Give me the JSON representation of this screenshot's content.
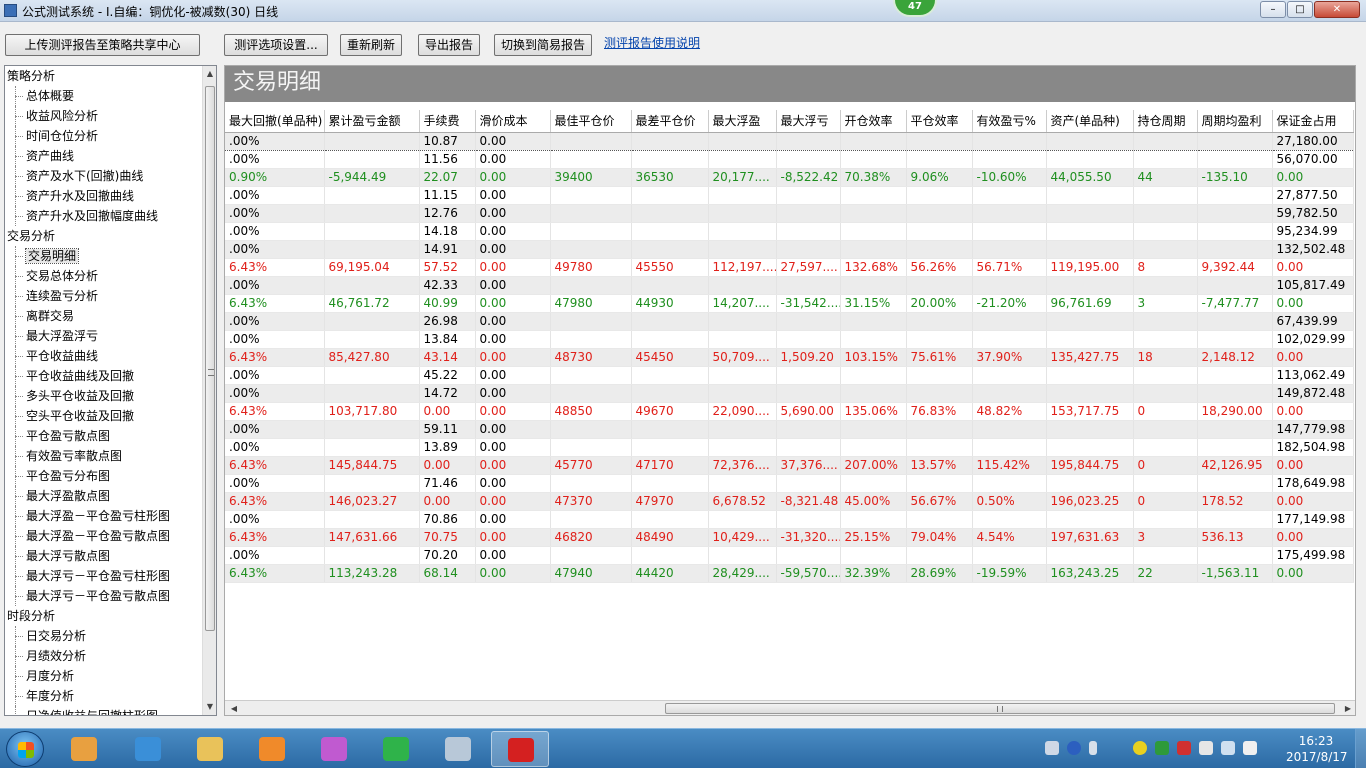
{
  "window": {
    "title": "公式测试系统 - I.自编：铜优化-被减数(30) 日线",
    "badge": "47",
    "min": "–",
    "max": "□",
    "close": "✕"
  },
  "toolbar": {
    "upload": "上传测评报告至策略共享中心",
    "options": "测评选项设置...",
    "refresh": "重新刷新",
    "export": "导出报告",
    "switch": "切换到简易报告",
    "help": "测评报告使用说明"
  },
  "tree": [
    {
      "label": "策略分析",
      "level": 0
    },
    {
      "label": "总体概要",
      "level": 1
    },
    {
      "label": "收益风险分析",
      "level": 1
    },
    {
      "label": "时间仓位分析",
      "level": 1
    },
    {
      "label": "资产曲线",
      "level": 1
    },
    {
      "label": "资产及水下(回撤)曲线",
      "level": 1
    },
    {
      "label": "资产升水及回撤曲线",
      "level": 1
    },
    {
      "label": "资产升水及回撤幅度曲线",
      "level": 1
    },
    {
      "label": "交易分析",
      "level": 0
    },
    {
      "label": "交易明细",
      "level": 1,
      "selected": true
    },
    {
      "label": "交易总体分析",
      "level": 1
    },
    {
      "label": "连续盈亏分析",
      "level": 1
    },
    {
      "label": "离群交易",
      "level": 1
    },
    {
      "label": "最大浮盈浮亏",
      "level": 1
    },
    {
      "label": "平仓收益曲线",
      "level": 1
    },
    {
      "label": "平仓收益曲线及回撤",
      "level": 1
    },
    {
      "label": "多头平仓收益及回撤",
      "level": 1
    },
    {
      "label": "空头平仓收益及回撤",
      "level": 1
    },
    {
      "label": "平仓盈亏散点图",
      "level": 1
    },
    {
      "label": "有效盈亏率散点图",
      "level": 1
    },
    {
      "label": "平仓盈亏分布图",
      "level": 1
    },
    {
      "label": "最大浮盈散点图",
      "level": 1
    },
    {
      "label": "最大浮盈－平仓盈亏柱形图",
      "level": 1
    },
    {
      "label": "最大浮盈－平仓盈亏散点图",
      "level": 1
    },
    {
      "label": "最大浮亏散点图",
      "level": 1
    },
    {
      "label": "最大浮亏－平仓盈亏柱形图",
      "level": 1
    },
    {
      "label": "最大浮亏－平仓盈亏散点图",
      "level": 1
    },
    {
      "label": "时段分析",
      "level": 0
    },
    {
      "label": "日交易分析",
      "level": 1
    },
    {
      "label": "月绩效分析",
      "level": 1
    },
    {
      "label": "月度分析",
      "level": 1
    },
    {
      "label": "年度分析",
      "level": 1
    },
    {
      "label": "日净值收益与回撤柱形图",
      "level": 1
    }
  ],
  "main": {
    "title": "交易明细",
    "columns": [
      "最大回撤(单品种)",
      "累计盈亏金额",
      "手续费",
      "滑价成本",
      "最佳平仓价",
      "最差平仓价",
      "最大浮盈",
      "最大浮亏",
      "开仓效率",
      "平仓效率",
      "有效盈亏%",
      "资产(单品种)",
      "持仓周期",
      "周期均盈利",
      "保证金占用"
    ],
    "rows": [
      {
        "color": "",
        "cells": [
          ".00%",
          "",
          "10.87",
          "0.00",
          "",
          "",
          "",
          "",
          "",
          "",
          "",
          "",
          "",
          "",
          "27,180.00"
        ]
      },
      {
        "color": "",
        "cells": [
          ".00%",
          "",
          "11.56",
          "0.00",
          "",
          "",
          "",
          "",
          "",
          "",
          "",
          "",
          "",
          "",
          "56,070.00"
        ]
      },
      {
        "color": "green",
        "cells": [
          "0.90%",
          "-5,944.49",
          "22.07",
          "0.00",
          "39400",
          "36530",
          "20,177....",
          "-8,522.42",
          "70.38%",
          "9.06%",
          "-10.60%",
          "44,055.50",
          "44",
          "-135.10",
          "0.00"
        ]
      },
      {
        "color": "",
        "cells": [
          ".00%",
          "",
          "11.15",
          "0.00",
          "",
          "",
          "",
          "",
          "",
          "",
          "",
          "",
          "",
          "",
          "27,877.50"
        ]
      },
      {
        "color": "",
        "cells": [
          ".00%",
          "",
          "12.76",
          "0.00",
          "",
          "",
          "",
          "",
          "",
          "",
          "",
          "",
          "",
          "",
          "59,782.50"
        ]
      },
      {
        "color": "",
        "cells": [
          ".00%",
          "",
          "14.18",
          "0.00",
          "",
          "",
          "",
          "",
          "",
          "",
          "",
          "",
          "",
          "",
          "95,234.99"
        ]
      },
      {
        "color": "",
        "cells": [
          ".00%",
          "",
          "14.91",
          "0.00",
          "",
          "",
          "",
          "",
          "",
          "",
          "",
          "",
          "",
          "",
          "132,502.48"
        ]
      },
      {
        "color": "red",
        "cells": [
          "6.43%",
          "69,195.04",
          "57.52",
          "0.00",
          "49780",
          "45550",
          "112,197....",
          "27,597....",
          "132.68%",
          "56.26%",
          "56.71%",
          "119,195.00",
          "8",
          "9,392.44",
          "0.00"
        ]
      },
      {
        "color": "",
        "cells": [
          ".00%",
          "",
          "42.33",
          "0.00",
          "",
          "",
          "",
          "",
          "",
          "",
          "",
          "",
          "",
          "",
          "105,817.49"
        ]
      },
      {
        "color": "green",
        "cells": [
          "6.43%",
          "46,761.72",
          "40.99",
          "0.00",
          "47980",
          "44930",
          "14,207....",
          "-31,542....",
          "31.15%",
          "20.00%",
          "-21.20%",
          "96,761.69",
          "3",
          "-7,477.77",
          "0.00"
        ]
      },
      {
        "color": "",
        "cells": [
          ".00%",
          "",
          "26.98",
          "0.00",
          "",
          "",
          "",
          "",
          "",
          "",
          "",
          "",
          "",
          "",
          "67,439.99"
        ]
      },
      {
        "color": "",
        "cells": [
          ".00%",
          "",
          "13.84",
          "0.00",
          "",
          "",
          "",
          "",
          "",
          "",
          "",
          "",
          "",
          "",
          "102,029.99"
        ]
      },
      {
        "color": "red",
        "cells": [
          "6.43%",
          "85,427.80",
          "43.14",
          "0.00",
          "48730",
          "45450",
          "50,709....",
          "1,509.20",
          "103.15%",
          "75.61%",
          "37.90%",
          "135,427.75",
          "18",
          "2,148.12",
          "0.00"
        ]
      },
      {
        "color": "",
        "cells": [
          ".00%",
          "",
          "45.22",
          "0.00",
          "",
          "",
          "",
          "",
          "",
          "",
          "",
          "",
          "",
          "",
          "113,062.49"
        ]
      },
      {
        "color": "",
        "cells": [
          ".00%",
          "",
          "14.72",
          "0.00",
          "",
          "",
          "",
          "",
          "",
          "",
          "",
          "",
          "",
          "",
          "149,872.48"
        ]
      },
      {
        "color": "red",
        "cells": [
          "6.43%",
          "103,717.80",
          "0.00",
          "0.00",
          "48850",
          "49670",
          "22,090....",
          "5,690.00",
          "135.06%",
          "76.83%",
          "48.82%",
          "153,717.75",
          "0",
          "18,290.00",
          "0.00"
        ]
      },
      {
        "color": "",
        "cells": [
          ".00%",
          "",
          "59.11",
          "0.00",
          "",
          "",
          "",
          "",
          "",
          "",
          "",
          "",
          "",
          "",
          "147,779.98"
        ]
      },
      {
        "color": "",
        "cells": [
          ".00%",
          "",
          "13.89",
          "0.00",
          "",
          "",
          "",
          "",
          "",
          "",
          "",
          "",
          "",
          "",
          "182,504.98"
        ]
      },
      {
        "color": "red",
        "cells": [
          "6.43%",
          "145,844.75",
          "0.00",
          "0.00",
          "45770",
          "47170",
          "72,376....",
          "37,376....",
          "207.00%",
          "13.57%",
          "115.42%",
          "195,844.75",
          "0",
          "42,126.95",
          "0.00"
        ]
      },
      {
        "color": "",
        "cells": [
          ".00%",
          "",
          "71.46",
          "0.00",
          "",
          "",
          "",
          "",
          "",
          "",
          "",
          "",
          "",
          "",
          "178,649.98"
        ]
      },
      {
        "color": "red",
        "cells": [
          "6.43%",
          "146,023.27",
          "0.00",
          "0.00",
          "47370",
          "47970",
          "6,678.52",
          "-8,321.48",
          "45.00%",
          "56.67%",
          "0.50%",
          "196,023.25",
          "0",
          "178.52",
          "0.00"
        ]
      },
      {
        "color": "",
        "cells": [
          ".00%",
          "",
          "70.86",
          "0.00",
          "",
          "",
          "",
          "",
          "",
          "",
          "",
          "",
          "",
          "",
          "177,149.98"
        ]
      },
      {
        "color": "red",
        "cells": [
          "6.43%",
          "147,631.66",
          "70.75",
          "0.00",
          "46820",
          "48490",
          "10,429....",
          "-31,320....",
          "25.15%",
          "79.04%",
          "4.54%",
          "197,631.63",
          "3",
          "536.13",
          "0.00"
        ]
      },
      {
        "color": "",
        "cells": [
          ".00%",
          "",
          "70.20",
          "0.00",
          "",
          "",
          "",
          "",
          "",
          "",
          "",
          "",
          "",
          "",
          "175,499.98"
        ]
      },
      {
        "color": "green",
        "cells": [
          "6.43%",
          "113,243.28",
          "68.14",
          "0.00",
          "47940",
          "44420",
          "28,429....",
          "-59,570....",
          "32.39%",
          "28.69%",
          "-19.59%",
          "163,243.25",
          "22",
          "-1,563.11",
          "0.00"
        ]
      }
    ]
  },
  "taskbar": {
    "time": "16:23",
    "date": "2017/8/17",
    "apps": [
      {
        "name": "app-icon-1",
        "color": "#e8a040"
      },
      {
        "name": "ie-icon",
        "color": "#3a8fd8"
      },
      {
        "name": "folder-icon",
        "color": "#e9c25a"
      },
      {
        "name": "media-icon",
        "color": "#f08a2a"
      },
      {
        "name": "color-wheel-icon",
        "color": "#c05ad0"
      },
      {
        "name": "s-app-icon",
        "color": "#2fb34a"
      },
      {
        "name": "notebook-icon",
        "color": "#b8c8d8"
      },
      {
        "name": "trading-app-icon",
        "color": "#d42020"
      }
    ]
  }
}
